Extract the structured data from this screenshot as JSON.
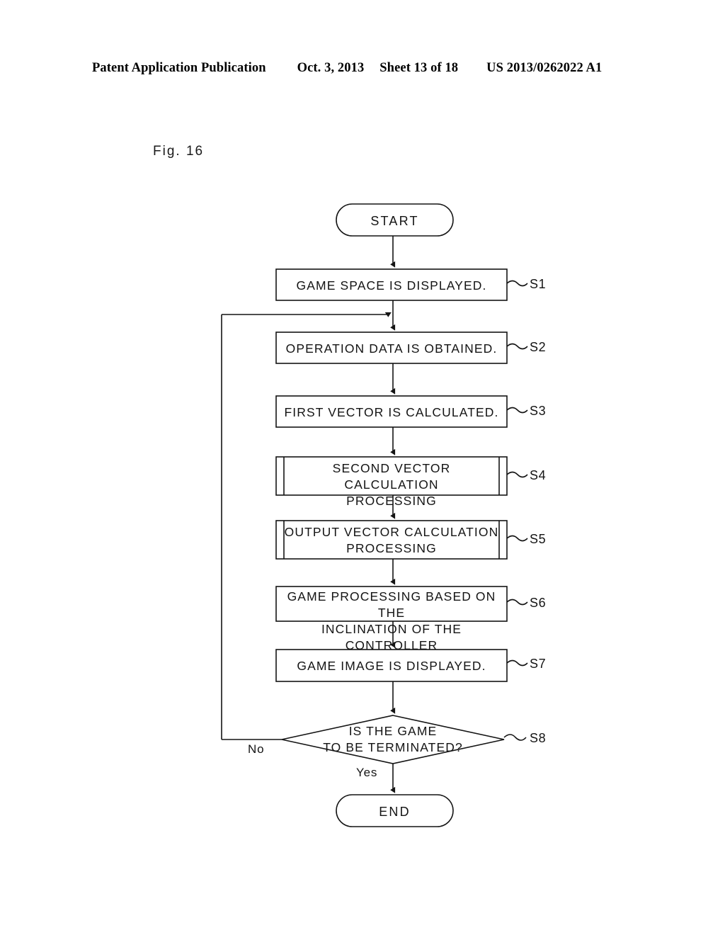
{
  "header": {
    "publication": "Patent Application Publication",
    "date": "Oct. 3, 2013",
    "sheet": "Sheet 13 of 18",
    "patent_number": "US 2013/0262022 A1"
  },
  "figure": {
    "label": "Fig. 16"
  },
  "flowchart": {
    "start_label": "START",
    "end_label": "END",
    "yes_label": "Yes",
    "no_label": "No",
    "steps": [
      {
        "id": "S1",
        "text": "GAME SPACE IS DISPLAYED.",
        "shape": "process"
      },
      {
        "id": "S2",
        "text": "OPERATION DATA IS OBTAINED.",
        "shape": "process"
      },
      {
        "id": "S3",
        "text": "FIRST VECTOR IS CALCULATED.",
        "shape": "process"
      },
      {
        "id": "S4",
        "text": "SECOND VECTOR CALCULATION\nPROCESSING",
        "shape": "subroutine"
      },
      {
        "id": "S5",
        "text": "OUTPUT VECTOR CALCULATION\nPROCESSING",
        "shape": "subroutine"
      },
      {
        "id": "S6",
        "text": "GAME PROCESSING BASED ON THE\nINCLINATION OF THE CONTROLLER",
        "shape": "process"
      },
      {
        "id": "S7",
        "text": "GAME IMAGE IS DISPLAYED.",
        "shape": "process"
      },
      {
        "id": "S8",
        "text": "IS THE GAME\nTO BE TERMINATED?",
        "shape": "decision"
      }
    ]
  },
  "colors": {
    "ink": "#141414",
    "paper": "#ffffff"
  }
}
